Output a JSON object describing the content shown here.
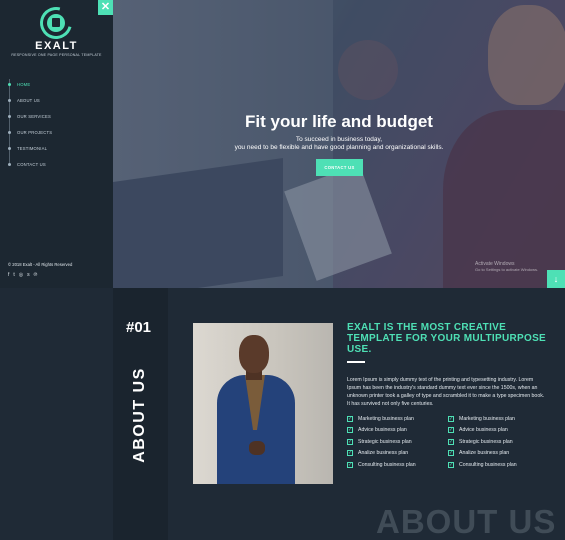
{
  "sidebar": {
    "logo_name": "EXALT",
    "logo_tagline": "RESPONSIVE ONE PAGE PERSONAL TEMPLATE",
    "close_icon": "close-icon",
    "nav": [
      {
        "label": "HOME",
        "active": true
      },
      {
        "label": "ABOUT US",
        "active": false
      },
      {
        "label": "OUR SERVICES",
        "active": false
      },
      {
        "label": "OUR PROJECTS",
        "active": false
      },
      {
        "label": "TESTIMONIAL",
        "active": false
      },
      {
        "label": "CONTACT US",
        "active": false
      }
    ],
    "copyright": "© 2018 Exalt - All Rights Reserved",
    "social_icons": [
      "facebook-icon",
      "twitter-icon",
      "instagram-icon",
      "skype-icon",
      "pinterest-icon"
    ]
  },
  "hero": {
    "title": "Fit your life and budget",
    "subtitle_line1": "To succeed in business today,",
    "subtitle_line2": "you need to be flexible and have good planning and organizational skills.",
    "button_label": "CONTACT US",
    "activate_title": "Activate Windows",
    "activate_sub": "Go to Settings to activate Windows.",
    "down_icon": "arrow-down-icon"
  },
  "about": {
    "number": "#01",
    "vertical_label": "ABOUT US",
    "title": "EXALT IS THE MOST CREATIVE TEMPLATE FOR YOUR MULTIPURPOSE USE.",
    "text": "Lorem Ipsum is simply dummy text of the printing and typesetting industry. Lorem Ipsum has been the industry's standard dummy text ever since the 1500s, when an unknown printer took a galley of type and scrambled it to make a type specimen book. It has survived not only five centuries.",
    "list_left": [
      "Marketing business plan",
      "Advice business plan",
      "Strategic business plan",
      "Analize business plan",
      "Consulting business plan"
    ],
    "list_right": [
      "Marketing business plan",
      "Advice business plan",
      "Strategic business plan",
      "Analize business plan",
      "Consulting business plan"
    ],
    "watermark": "ABOUT US"
  },
  "colors": {
    "accent": "#4ee0b5",
    "sidebar_bg": "#1c2731",
    "page_bg": "#1f2a36"
  }
}
